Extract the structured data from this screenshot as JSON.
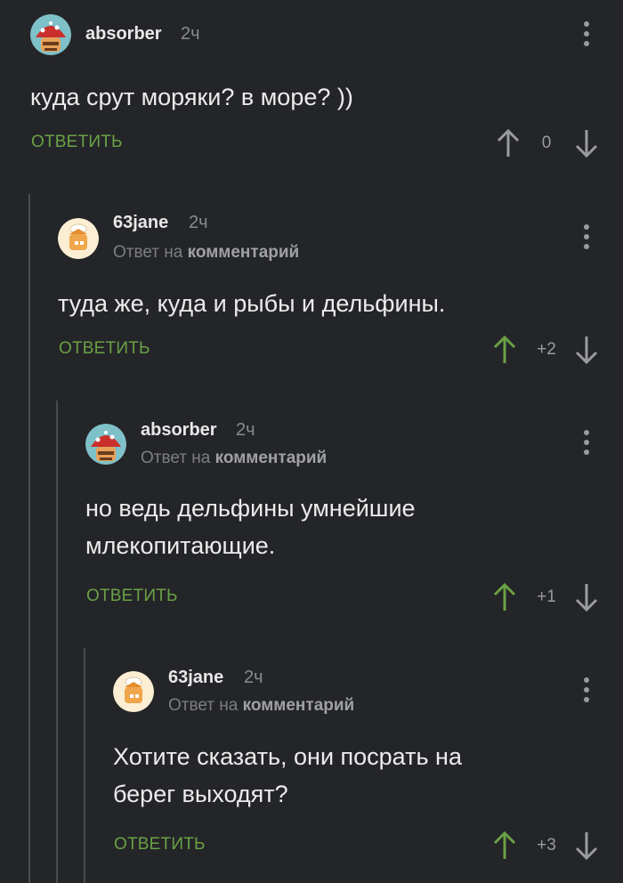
{
  "comments": [
    {
      "username": "absorber",
      "time": "2ч",
      "reply_prefix": "",
      "reply_target": "",
      "text_lines": [
        "куда срут моряки? в море? ))"
      ],
      "reply_label": "ОТВЕТИТЬ",
      "score": "0",
      "upvoted": false
    },
    {
      "username": "63jane",
      "time": "2ч",
      "reply_prefix": "Ответ на",
      "reply_target": "комментарий",
      "text_lines": [
        "туда же, куда и рыбы и дельфины."
      ],
      "reply_label": "ОТВЕТИТЬ",
      "score": "+2",
      "upvoted": true
    },
    {
      "username": "absorber",
      "time": "2ч",
      "reply_prefix": "Ответ на",
      "reply_target": "комментарий",
      "text_lines": [
        "но ведь дельфины умнейшие",
        "млекопитающие."
      ],
      "reply_label": "ОТВЕТИТЬ",
      "score": "+1",
      "upvoted": true
    },
    {
      "username": "63jane",
      "time": "2ч",
      "reply_prefix": "Ответ на",
      "reply_target": "комментарий",
      "text_lines": [
        "Хотите сказать, они посрать на",
        "берег выходят?"
      ],
      "reply_label": "ОТВЕТИТЬ",
      "score": "+3",
      "upvoted": true
    }
  ],
  "colors": {
    "background": "#242528",
    "accent_green": "#6aa145",
    "muted": "#9a9b9f"
  },
  "icons": [
    "avatar-absorber",
    "avatar-63jane",
    "more-vertical-icon",
    "arrow-up-icon",
    "arrow-down-icon"
  ]
}
